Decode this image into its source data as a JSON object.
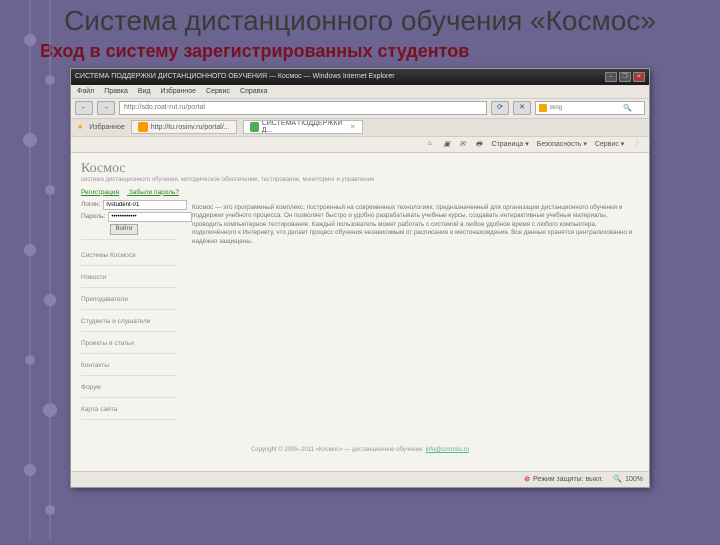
{
  "slide": {
    "title": "Система дистанционного обучения «Космос»",
    "subtitle": "Вход в систему зарегистрированных студентов"
  },
  "browser": {
    "window_title": "СИСТЕМА ПОДДЕРЖКИ ДИСТАНЦИОННОГО ОБУЧЕНИЯ — Космос — Windows Internet Explorer",
    "menu": [
      "Файл",
      "Правка",
      "Вид",
      "Избранное",
      "Сервис",
      "Справка"
    ],
    "nav": {
      "back": "←",
      "fwd": "→",
      "address": "http://sdo.roat-rut.ru/portal",
      "refresh": "⟳",
      "stop": "✕"
    },
    "search": {
      "placeholder": "Bing"
    },
    "fav_label": "Избранное",
    "tabs": [
      {
        "label": "http://tu.rosinv.ru/portal/..."
      },
      {
        "label": "СИСТЕМА ПОДДЕРЖКИ Д..."
      }
    ],
    "toolbar": {
      "home": "⌂",
      "rss": "▣",
      "mail": "✉",
      "print": "🖶",
      "page": "Страница ▾",
      "safety": "Безопасность ▾",
      "tools": "Сервис ▾",
      "help": "❔"
    }
  },
  "page": {
    "brand": "Космос",
    "tagline": "система дистанционного обучения, методическое обеспечение, тестирование, мониторинг и управление",
    "greenlinks": [
      "Регистрация",
      "Забыли пароль?"
    ],
    "login": {
      "user_label": "Логин:",
      "user_value": "Ivstudent-01",
      "pass_label": "Пароль:",
      "pass_value": "••••••••••••",
      "button": "Войти"
    },
    "sidebar": [
      "Системы Космоса",
      "Новости",
      "Преподаватели",
      "Студенты и слушатели",
      "Проекты и статьи",
      "Контакты",
      "Форум",
      "Карта сайта"
    ],
    "paragraph": "Космос — это программный комплекс, построенный на современных технологиях, предназначенный для организации дистанционного обучения и поддержки учебного процесса. Он позволяет быстро и удобно разрабатывать учебные курсы, создавать интерактивные учебные материалы, проводить компьютерное тестирование. Каждый пользователь может работать с системой в любое удобное время с любого компьютера, подключённого к Интернету, что делает процесс обучения независимым от расписания и местонахождения. Все данные хранятся централизованно и надёжно защищены.",
    "footer_text": "Copyright © 2005–2011 «Космос» — дистанционное обучение",
    "footer_link": "info@cosmos.ru"
  },
  "status": {
    "security": "Режим защиты: выкл.",
    "zoom": "100%"
  }
}
